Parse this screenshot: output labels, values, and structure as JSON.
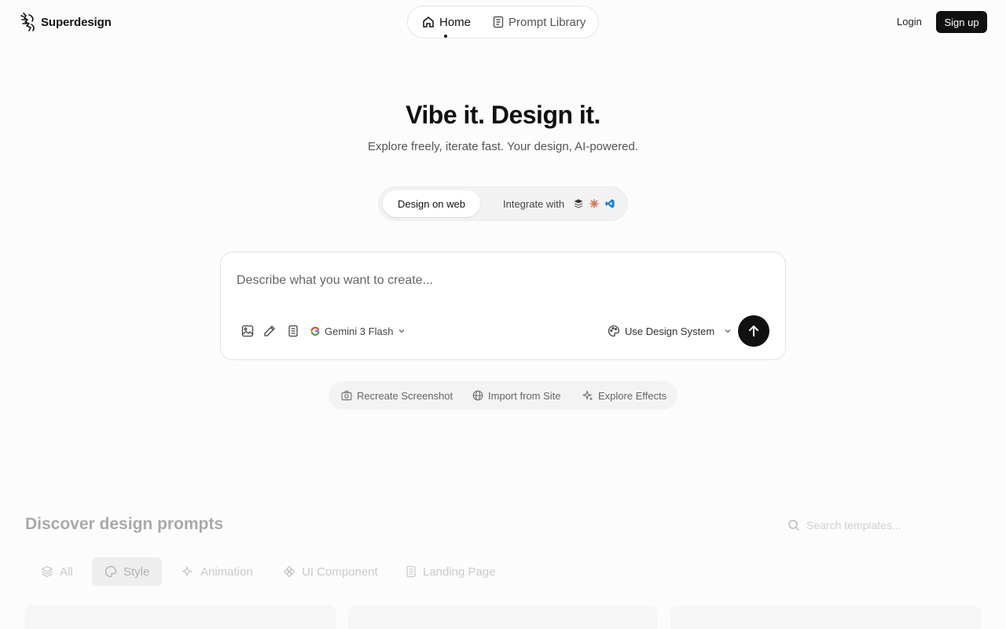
{
  "brand": {
    "name": "Superdesign",
    "logo_icon": "zebra-logo-icon"
  },
  "nav": {
    "items": [
      {
        "label": "Home",
        "icon": "home-icon",
        "active": true
      },
      {
        "label": "Prompt Library",
        "icon": "book-icon",
        "active": false
      }
    ]
  },
  "auth": {
    "login_label": "Login",
    "signup_label": "Sign up"
  },
  "hero": {
    "title": "Vibe it. Design it.",
    "subtitle": "Explore freely, iterate fast. Your design, AI-powered."
  },
  "mode": {
    "web_label": "Design on web",
    "integrate_label": "Integrate with",
    "integrate_icons": [
      "layers-icon",
      "claude-icon",
      "vscode-icon"
    ]
  },
  "prompt": {
    "placeholder": "Describe what you want to create...",
    "value": "",
    "tools": [
      "image-icon",
      "pencil-icon",
      "document-icon"
    ],
    "model_label": "Gemini 3 Flash",
    "design_system_label": "Use Design System"
  },
  "quick_actions": [
    {
      "label": "Recreate Screenshot",
      "icon": "camera-icon"
    },
    {
      "label": "Import from Site",
      "icon": "globe-icon"
    },
    {
      "label": "Explore Effects",
      "icon": "sparkle-icon"
    }
  ],
  "discover": {
    "title": "Discover design prompts",
    "search_placeholder": "Search templates...",
    "categories": [
      {
        "label": "All",
        "icon": "stack-icon",
        "active": false
      },
      {
        "label": "Style",
        "icon": "palette-icon",
        "active": true
      },
      {
        "label": "Animation",
        "icon": "sparkle-icon",
        "active": false
      },
      {
        "label": "UI Component",
        "icon": "component-icon",
        "active": false
      },
      {
        "label": "Landing Page",
        "icon": "page-icon",
        "active": false
      }
    ]
  },
  "colors": {
    "primary": "#111111",
    "background": "#fcfcfc",
    "muted_text": "#555555"
  }
}
